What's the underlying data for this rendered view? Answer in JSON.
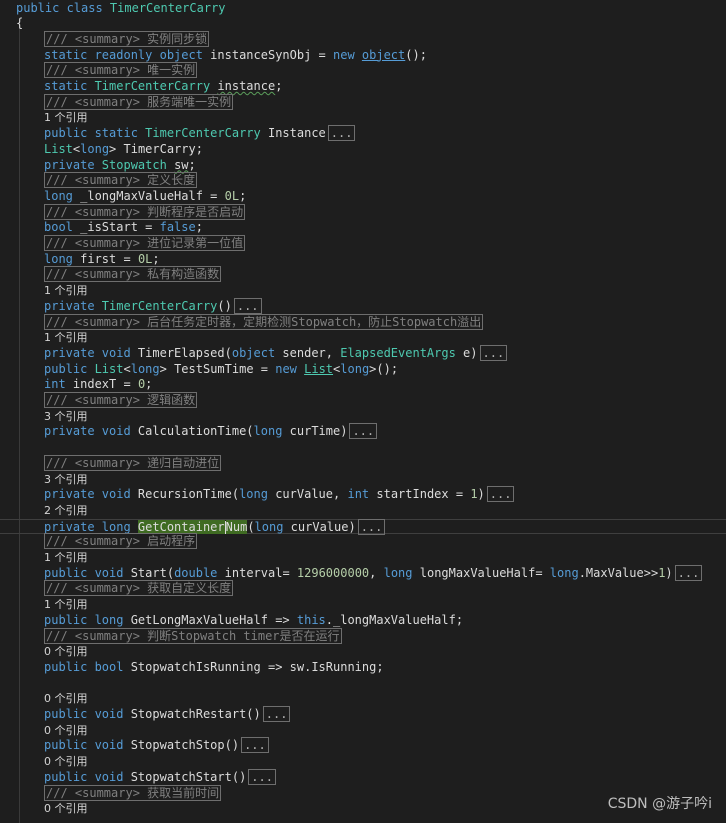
{
  "editor": {
    "colors": {
      "background": "#1e1e1e",
      "keyword": "#569cd6",
      "type": "#4ec9b0",
      "text": "#dcdcdc",
      "highlight": "#3f6b22"
    },
    "lines": [
      {
        "indent": 2,
        "tokens": [
          [
            "kw",
            "public class "
          ],
          [
            "ty",
            "TimerCenterCarry"
          ]
        ]
      },
      {
        "indent": 2,
        "tokens": [
          [
            "tx",
            "{"
          ]
        ]
      },
      {
        "indent": 44,
        "tokens": [
          [
            "cf",
            "/// <summary> 实例同步锁"
          ]
        ]
      },
      {
        "indent": 44,
        "tokens": [
          [
            "kw",
            "static readonly "
          ],
          [
            "kw",
            "object"
          ],
          [
            "tx",
            " instanceSynObj = "
          ],
          [
            "kw",
            "new "
          ],
          [
            "ulk",
            "object"
          ],
          [
            "tx",
            "();"
          ]
        ]
      },
      {
        "indent": 44,
        "tokens": [
          [
            "cf",
            "/// <summary> 唯一实例"
          ]
        ]
      },
      {
        "indent": 44,
        "tokens": [
          [
            "kw",
            "static "
          ],
          [
            "ty",
            "TimerCenterCarry"
          ],
          [
            "tx",
            " "
          ],
          [
            "sq",
            "instance"
          ],
          [
            "tx",
            ";"
          ]
        ]
      },
      {
        "indent": 44,
        "tokens": [
          [
            "cf",
            "/// <summary> 服务端唯一实例"
          ]
        ]
      },
      {
        "indent": 44,
        "tokens": [
          [
            "rf",
            "1 个引用"
          ]
        ]
      },
      {
        "indent": 44,
        "tokens": [
          [
            "kw",
            "public static "
          ],
          [
            "ty",
            "TimerCenterCarry"
          ],
          [
            "tx",
            " Instance"
          ],
          [
            "clp",
            "..."
          ]
        ]
      },
      {
        "indent": 44,
        "tokens": [
          [
            "ty",
            "List"
          ],
          [
            "tx",
            "<"
          ],
          [
            "kw",
            "long"
          ],
          [
            "tx",
            "> "
          ],
          [
            "tx",
            "TimerCarry;"
          ]
        ]
      },
      {
        "indent": 44,
        "tokens": [
          [
            "kw",
            "private "
          ],
          [
            "ty",
            "Stopwatch"
          ],
          [
            "tx",
            " "
          ],
          [
            "sq",
            "sw"
          ],
          [
            "tx",
            ";"
          ]
        ]
      },
      {
        "indent": 44,
        "tokens": [
          [
            "cf",
            "/// <summary> 定义长度"
          ]
        ]
      },
      {
        "indent": 44,
        "tokens": [
          [
            "kw",
            "long"
          ],
          [
            "tx",
            " _longMaxValueHalf = "
          ],
          [
            "nm",
            "0L"
          ],
          [
            "tx",
            ";"
          ]
        ]
      },
      {
        "indent": 44,
        "tokens": [
          [
            "cf",
            "/// <summary> 判断程序是否启动"
          ]
        ]
      },
      {
        "indent": 44,
        "tokens": [
          [
            "kw",
            "bool"
          ],
          [
            "tx",
            " _isStart = "
          ],
          [
            "kw",
            "false"
          ],
          [
            "tx",
            ";"
          ]
        ]
      },
      {
        "indent": 44,
        "tokens": [
          [
            "cf",
            "/// <summary> 进位记录第一位值"
          ]
        ]
      },
      {
        "indent": 44,
        "tokens": [
          [
            "kw",
            "long"
          ],
          [
            "tx",
            " first = "
          ],
          [
            "nm",
            "0L"
          ],
          [
            "tx",
            ";"
          ]
        ]
      },
      {
        "indent": 44,
        "tokens": [
          [
            "cf",
            "/// <summary> 私有构造函数"
          ]
        ]
      },
      {
        "indent": 44,
        "tokens": [
          [
            "rf",
            "1 个引用"
          ]
        ]
      },
      {
        "indent": 44,
        "tokens": [
          [
            "kw",
            "private "
          ],
          [
            "ty",
            "TimerCenterCarry"
          ],
          [
            "tx",
            "()"
          ],
          [
            "clp",
            "..."
          ]
        ]
      },
      {
        "indent": 44,
        "tokens": [
          [
            "cf",
            "/// <summary> 后台任务定时器，定期检测Stopwatch，防止Stopwatch溢出"
          ]
        ]
      },
      {
        "indent": 44,
        "tokens": [
          [
            "rf",
            "1 个引用"
          ]
        ]
      },
      {
        "indent": 44,
        "tokens": [
          [
            "kw",
            "private void "
          ],
          [
            "tx",
            "TimerElapsed("
          ],
          [
            "kw",
            "object"
          ],
          [
            "tx",
            " sender, "
          ],
          [
            "ty",
            "ElapsedEventArgs"
          ],
          [
            "tx",
            " e)"
          ],
          [
            "clp",
            "..."
          ]
        ]
      },
      {
        "indent": 44,
        "tokens": [
          [
            "kw",
            "public "
          ],
          [
            "ty",
            "List"
          ],
          [
            "tx",
            "<"
          ],
          [
            "kw",
            "long"
          ],
          [
            "tx",
            "> TestSumTime = "
          ],
          [
            "kw",
            "new "
          ],
          [
            "ul",
            "List"
          ],
          [
            "tx",
            "<"
          ],
          [
            "kw",
            "long"
          ],
          [
            "tx",
            ">();"
          ]
        ]
      },
      {
        "indent": 44,
        "tokens": [
          [
            "kw",
            "int"
          ],
          [
            "tx",
            " indexT = "
          ],
          [
            "nm",
            "0"
          ],
          [
            "tx",
            ";"
          ]
        ]
      },
      {
        "indent": 44,
        "tokens": [
          [
            "cf",
            "/// <summary> 逻辑函数"
          ]
        ]
      },
      {
        "indent": 44,
        "tokens": [
          [
            "rf",
            "3 个引用"
          ]
        ]
      },
      {
        "indent": 44,
        "tokens": [
          [
            "kw",
            "private void "
          ],
          [
            "tx",
            "CalculationTime("
          ],
          [
            "kw",
            "long"
          ],
          [
            "tx",
            " curTime)"
          ],
          [
            "clp",
            "..."
          ]
        ]
      },
      {
        "indent": 44,
        "tokens": []
      },
      {
        "indent": 44,
        "tokens": [
          [
            "cf",
            "/// <summary> 递归自动进位"
          ]
        ]
      },
      {
        "indent": 44,
        "tokens": [
          [
            "rf",
            "3 个引用"
          ]
        ]
      },
      {
        "indent": 44,
        "tokens": [
          [
            "kw",
            "private void "
          ],
          [
            "tx",
            "RecursionTime("
          ],
          [
            "kw",
            "long"
          ],
          [
            "tx",
            " curValue, "
          ],
          [
            "kw",
            "int"
          ],
          [
            "tx",
            " startIndex = "
          ],
          [
            "nm",
            "1"
          ],
          [
            "tx",
            ")"
          ],
          [
            "clp",
            "..."
          ]
        ]
      },
      {
        "indent": 44,
        "tokens": [
          [
            "rf",
            "2 个引用"
          ]
        ]
      },
      {
        "indent": 44,
        "current": true,
        "tokens": [
          [
            "kw",
            "private long "
          ],
          [
            "hl",
            "GetContainer"
          ],
          [
            "caret",
            ""
          ],
          [
            "hl",
            "Num"
          ],
          [
            "tx",
            "("
          ],
          [
            "kw",
            "long"
          ],
          [
            "tx",
            " curValue)"
          ],
          [
            "clp",
            "..."
          ]
        ]
      },
      {
        "indent": 44,
        "tokens": [
          [
            "cf",
            "/// <summary> 启动程序"
          ]
        ]
      },
      {
        "indent": 44,
        "tokens": [
          [
            "rf",
            "1 个引用"
          ]
        ]
      },
      {
        "indent": 44,
        "tokens": [
          [
            "kw",
            "public void "
          ],
          [
            "tx",
            "Start("
          ],
          [
            "kw",
            "double"
          ],
          [
            "tx",
            " interval= "
          ],
          [
            "nm",
            "1296000000"
          ],
          [
            "tx",
            ", "
          ],
          [
            "kw",
            "long"
          ],
          [
            "tx",
            " longMaxValueHalf= "
          ],
          [
            "kw",
            "long"
          ],
          [
            "tx",
            ".MaxValue>>"
          ],
          [
            "nm",
            "1"
          ],
          [
            "tx",
            ")"
          ],
          [
            "clp",
            "..."
          ]
        ]
      },
      {
        "indent": 44,
        "tokens": [
          [
            "cf",
            "/// <summary> 获取自定义长度"
          ]
        ]
      },
      {
        "indent": 44,
        "tokens": [
          [
            "rf",
            "1 个引用"
          ]
        ]
      },
      {
        "indent": 44,
        "tokens": [
          [
            "kw",
            "public long "
          ],
          [
            "tx",
            "GetLongMaxValueHalf => "
          ],
          [
            "kw",
            "this"
          ],
          [
            "tx",
            "._longMaxValueHalf;"
          ]
        ]
      },
      {
        "indent": 44,
        "tokens": [
          [
            "cf",
            "/// <summary> 判断Stopwatch timer是否在运行"
          ]
        ]
      },
      {
        "indent": 44,
        "tokens": [
          [
            "rf",
            "0 个引用"
          ]
        ]
      },
      {
        "indent": 44,
        "tokens": [
          [
            "kw",
            "public bool "
          ],
          [
            "tx",
            "StopwatchIsRunning => sw.IsRunning;"
          ]
        ]
      },
      {
        "indent": 44,
        "tokens": []
      },
      {
        "indent": 44,
        "tokens": [
          [
            "rf",
            "0 个引用"
          ]
        ]
      },
      {
        "indent": 44,
        "tokens": [
          [
            "kw",
            "public void "
          ],
          [
            "tx",
            "StopwatchRestart()"
          ],
          [
            "clp",
            "..."
          ]
        ]
      },
      {
        "indent": 44,
        "tokens": [
          [
            "rf",
            "0 个引用"
          ]
        ]
      },
      {
        "indent": 44,
        "tokens": [
          [
            "kw",
            "public void "
          ],
          [
            "tx",
            "StopwatchStop()"
          ],
          [
            "clp",
            "..."
          ]
        ]
      },
      {
        "indent": 44,
        "tokens": [
          [
            "rf",
            "0 个引用"
          ]
        ]
      },
      {
        "indent": 44,
        "tokens": [
          [
            "kw",
            "public void "
          ],
          [
            "tx",
            "StopwatchStart()"
          ],
          [
            "clp",
            "..."
          ]
        ]
      },
      {
        "indent": 44,
        "tokens": [
          [
            "cf",
            "/// <summary> 获取当前时间"
          ]
        ]
      },
      {
        "indent": 44,
        "tokens": [
          [
            "rf",
            "0 个引用"
          ]
        ]
      }
    ]
  },
  "watermark": "CSDN @游子吟i"
}
